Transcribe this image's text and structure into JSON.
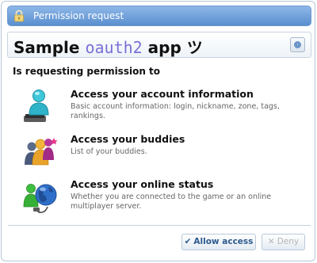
{
  "window": {
    "title": "Permission request"
  },
  "app": {
    "name_prefix": "Sample ",
    "name_highlight": "oauth2",
    "name_suffix": " app  ツ"
  },
  "request_heading": "Is requesting permission to",
  "permissions": [
    {
      "icon": "account-icon",
      "title": "Access your account information",
      "description": "Basic account information: login, nickname, zone, tags, rankings."
    },
    {
      "icon": "buddies-icon",
      "title": "Access your buddies",
      "description": "List of your buddies."
    },
    {
      "icon": "online-status-icon",
      "title": "Access your online status",
      "description": "Whether you are connected to the game or an online multiplayer server."
    }
  ],
  "buttons": {
    "allow": "Allow access",
    "deny": "Deny"
  },
  "colors": {
    "titlebar": "#6b9bd6",
    "app_highlight": "#7b6fd6",
    "allow_text": "#2d5a8e",
    "deny_text": "#b5b5b5"
  }
}
